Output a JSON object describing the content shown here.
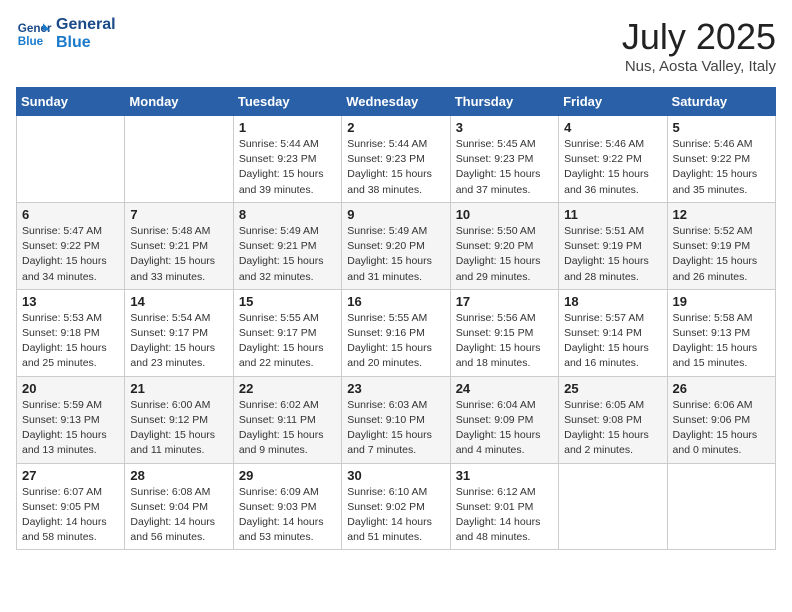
{
  "logo": {
    "line1": "General",
    "line2": "Blue"
  },
  "title": "July 2025",
  "subtitle": "Nus, Aosta Valley, Italy",
  "days_of_week": [
    "Sunday",
    "Monday",
    "Tuesday",
    "Wednesday",
    "Thursday",
    "Friday",
    "Saturday"
  ],
  "weeks": [
    [
      {
        "day": "",
        "info": ""
      },
      {
        "day": "",
        "info": ""
      },
      {
        "day": "1",
        "info": "Sunrise: 5:44 AM\nSunset: 9:23 PM\nDaylight: 15 hours\nand 39 minutes."
      },
      {
        "day": "2",
        "info": "Sunrise: 5:44 AM\nSunset: 9:23 PM\nDaylight: 15 hours\nand 38 minutes."
      },
      {
        "day": "3",
        "info": "Sunrise: 5:45 AM\nSunset: 9:23 PM\nDaylight: 15 hours\nand 37 minutes."
      },
      {
        "day": "4",
        "info": "Sunrise: 5:46 AM\nSunset: 9:22 PM\nDaylight: 15 hours\nand 36 minutes."
      },
      {
        "day": "5",
        "info": "Sunrise: 5:46 AM\nSunset: 9:22 PM\nDaylight: 15 hours\nand 35 minutes."
      }
    ],
    [
      {
        "day": "6",
        "info": "Sunrise: 5:47 AM\nSunset: 9:22 PM\nDaylight: 15 hours\nand 34 minutes."
      },
      {
        "day": "7",
        "info": "Sunrise: 5:48 AM\nSunset: 9:21 PM\nDaylight: 15 hours\nand 33 minutes."
      },
      {
        "day": "8",
        "info": "Sunrise: 5:49 AM\nSunset: 9:21 PM\nDaylight: 15 hours\nand 32 minutes."
      },
      {
        "day": "9",
        "info": "Sunrise: 5:49 AM\nSunset: 9:20 PM\nDaylight: 15 hours\nand 31 minutes."
      },
      {
        "day": "10",
        "info": "Sunrise: 5:50 AM\nSunset: 9:20 PM\nDaylight: 15 hours\nand 29 minutes."
      },
      {
        "day": "11",
        "info": "Sunrise: 5:51 AM\nSunset: 9:19 PM\nDaylight: 15 hours\nand 28 minutes."
      },
      {
        "day": "12",
        "info": "Sunrise: 5:52 AM\nSunset: 9:19 PM\nDaylight: 15 hours\nand 26 minutes."
      }
    ],
    [
      {
        "day": "13",
        "info": "Sunrise: 5:53 AM\nSunset: 9:18 PM\nDaylight: 15 hours\nand 25 minutes."
      },
      {
        "day": "14",
        "info": "Sunrise: 5:54 AM\nSunset: 9:17 PM\nDaylight: 15 hours\nand 23 minutes."
      },
      {
        "day": "15",
        "info": "Sunrise: 5:55 AM\nSunset: 9:17 PM\nDaylight: 15 hours\nand 22 minutes."
      },
      {
        "day": "16",
        "info": "Sunrise: 5:55 AM\nSunset: 9:16 PM\nDaylight: 15 hours\nand 20 minutes."
      },
      {
        "day": "17",
        "info": "Sunrise: 5:56 AM\nSunset: 9:15 PM\nDaylight: 15 hours\nand 18 minutes."
      },
      {
        "day": "18",
        "info": "Sunrise: 5:57 AM\nSunset: 9:14 PM\nDaylight: 15 hours\nand 16 minutes."
      },
      {
        "day": "19",
        "info": "Sunrise: 5:58 AM\nSunset: 9:13 PM\nDaylight: 15 hours\nand 15 minutes."
      }
    ],
    [
      {
        "day": "20",
        "info": "Sunrise: 5:59 AM\nSunset: 9:13 PM\nDaylight: 15 hours\nand 13 minutes."
      },
      {
        "day": "21",
        "info": "Sunrise: 6:00 AM\nSunset: 9:12 PM\nDaylight: 15 hours\nand 11 minutes."
      },
      {
        "day": "22",
        "info": "Sunrise: 6:02 AM\nSunset: 9:11 PM\nDaylight: 15 hours\nand 9 minutes."
      },
      {
        "day": "23",
        "info": "Sunrise: 6:03 AM\nSunset: 9:10 PM\nDaylight: 15 hours\nand 7 minutes."
      },
      {
        "day": "24",
        "info": "Sunrise: 6:04 AM\nSunset: 9:09 PM\nDaylight: 15 hours\nand 4 minutes."
      },
      {
        "day": "25",
        "info": "Sunrise: 6:05 AM\nSunset: 9:08 PM\nDaylight: 15 hours\nand 2 minutes."
      },
      {
        "day": "26",
        "info": "Sunrise: 6:06 AM\nSunset: 9:06 PM\nDaylight: 15 hours\nand 0 minutes."
      }
    ],
    [
      {
        "day": "27",
        "info": "Sunrise: 6:07 AM\nSunset: 9:05 PM\nDaylight: 14 hours\nand 58 minutes."
      },
      {
        "day": "28",
        "info": "Sunrise: 6:08 AM\nSunset: 9:04 PM\nDaylight: 14 hours\nand 56 minutes."
      },
      {
        "day": "29",
        "info": "Sunrise: 6:09 AM\nSunset: 9:03 PM\nDaylight: 14 hours\nand 53 minutes."
      },
      {
        "day": "30",
        "info": "Sunrise: 6:10 AM\nSunset: 9:02 PM\nDaylight: 14 hours\nand 51 minutes."
      },
      {
        "day": "31",
        "info": "Sunrise: 6:12 AM\nSunset: 9:01 PM\nDaylight: 14 hours\nand 48 minutes."
      },
      {
        "day": "",
        "info": ""
      },
      {
        "day": "",
        "info": ""
      }
    ]
  ]
}
